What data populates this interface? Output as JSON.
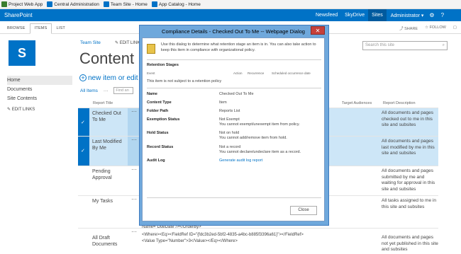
{
  "favorites": [
    {
      "label": "Project Web App",
      "color": "#3a7d2e"
    },
    {
      "label": "Central Administration",
      "color": "#0072c6"
    },
    {
      "label": "Team Site - Home",
      "color": "#0072c6"
    },
    {
      "label": "App Catalog - Home",
      "color": "#0072c6"
    }
  ],
  "suitebar": {
    "brand": "SharePoint",
    "links": [
      "Newsfeed",
      "SkyDrive",
      "Sites"
    ],
    "active": "Sites",
    "user": "Administrator ▾",
    "icons": [
      "gear-icon",
      "help-icon"
    ]
  },
  "ribbon": {
    "tabs": [
      "BROWSE",
      "ITEMS",
      "LIST"
    ],
    "selected": "ITEMS",
    "right": [
      "SHARE",
      "FOLLOW"
    ]
  },
  "header": {
    "breadcrumb": "Team Site",
    "edit_links": "EDIT LINKS",
    "title": "Content an",
    "search_placeholder": "Search this site"
  },
  "leftnav": {
    "items": [
      "Home",
      "Documents",
      "Site Contents"
    ],
    "selected": "Home",
    "edit_links": "EDIT LINKS"
  },
  "main": {
    "new_item": "new item or edit t",
    "views": [
      "All Items",
      "···"
    ],
    "find_placeholder": "Find an",
    "columns": {
      "title": "Report Title",
      "audiences": "Target Audiences",
      "description": "Report Description"
    },
    "rows": [
      {
        "title": "Checked Out To Me",
        "selected": true,
        "description": "All documents and pages checked out to me in this site and subsites"
      },
      {
        "title": "Last Modified By Me",
        "selected": true,
        "description": "All documents and pages last modified by me in this site and subsites"
      },
      {
        "title": "Pending Approval",
        "selected": false,
        "description": "All documents and pages submitted by me and waiting for approval in this site and subsites"
      },
      {
        "title": "My Tasks",
        "selected": false,
        "description": "All tasks assigned to me in this site and subsites"
      },
      {
        "title": "All Draft Documents",
        "selected": false,
        "description": "All documents and pages not yet published in this site and subsites"
      }
    ],
    "code_line1": "Name=\"DueDate\"/></OrderBy>",
    "code_line2": "<Where><Eq><FieldRef ID=\"{fdc3b2ed-5bf2-4835-a4bc-b885f3396a61}\"></FieldRef><Value Type=\"Number\">3</Value></Eq></Where>"
  },
  "dialog": {
    "title": "Compliance Details - Checked Out To Me -- Webpage Dialog",
    "intro": "Use this dialog to determine what retention stage an item is in. You can also take action to keep this item in compliance with organizational policy.",
    "retention_heading": "Retention Stages",
    "stage_columns": [
      "Event",
      "Action",
      "Recurrence",
      "Scheduled occurrence date"
    ],
    "stage_note": "This item is not subject to a retention policy",
    "properties": [
      {
        "label": "Name",
        "value": "Checked Out To Me",
        "sub": ""
      },
      {
        "label": "Content Type",
        "value": "Item",
        "sub": ""
      },
      {
        "label": "Folder Path",
        "value": "Reports List",
        "sub": ""
      },
      {
        "label": "Exemption Status",
        "value": "Not Exempt",
        "sub": "You cannot exempt/unexempt item from policy."
      },
      {
        "label": "Hold Status",
        "value": "Not on hold",
        "sub": "You cannot add/remove item from hold."
      },
      {
        "label": "Record Status",
        "value": "Not a record",
        "sub": "You cannot declare/undeclare item as a record."
      },
      {
        "label": "Audit Log",
        "value": "Generate audit log report",
        "sub": ""
      }
    ],
    "close_label": "Close"
  }
}
